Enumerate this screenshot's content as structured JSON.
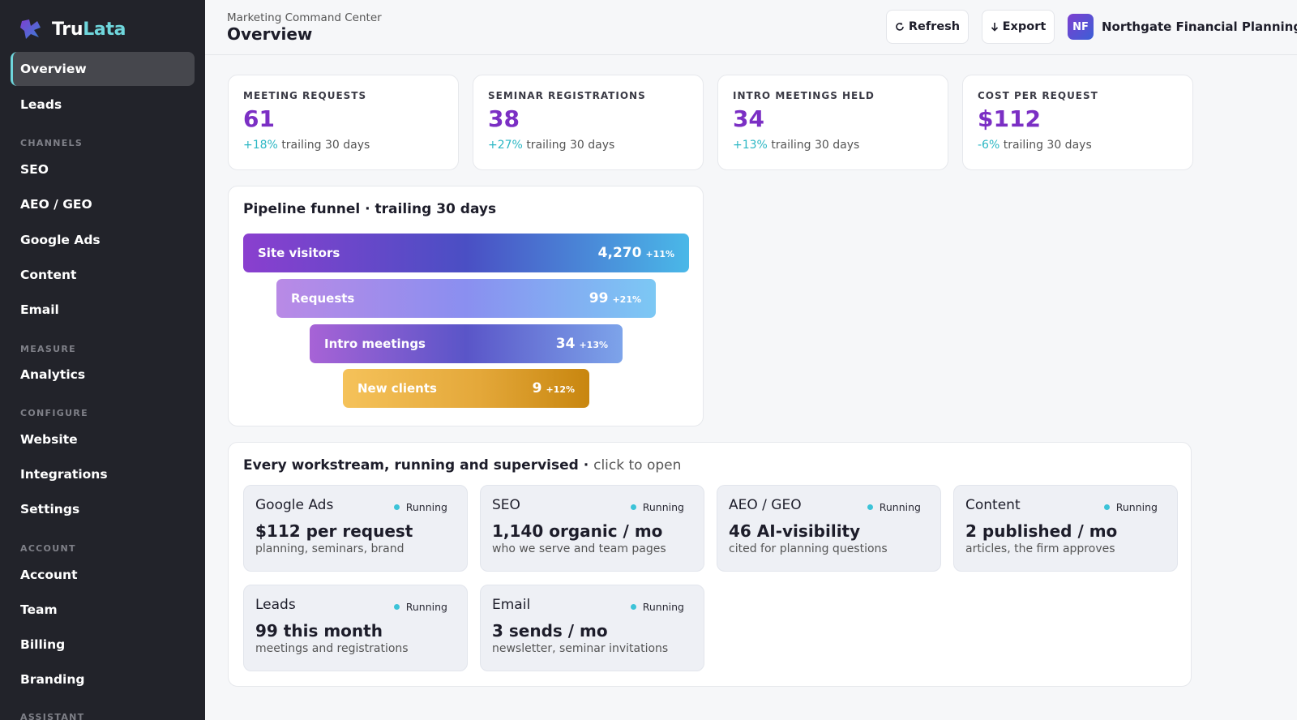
{
  "brand": {
    "name_primary": "Tru",
    "name_accent": "Lata"
  },
  "sidebar": {
    "items": [
      {
        "label": "Overview"
      },
      {
        "label": "Leads"
      },
      {
        "label": "SEO"
      },
      {
        "label": "AEO / GEO"
      },
      {
        "label": "Google Ads"
      },
      {
        "label": "Content"
      },
      {
        "label": "Email"
      },
      {
        "label": "Analytics"
      },
      {
        "label": "Website"
      },
      {
        "label": "Integrations"
      },
      {
        "label": "Settings"
      },
      {
        "label": "Account"
      },
      {
        "label": "Team"
      },
      {
        "label": "Billing"
      },
      {
        "label": "Branding"
      }
    ],
    "sections": {
      "channels": "CHANNELS",
      "measure": "MEASURE",
      "configure": "CONFIGURE",
      "account": "ACCOUNT",
      "assistant": "ASSISTANT"
    }
  },
  "header": {
    "breadcrumb": "Marketing Command Center",
    "title": "Overview",
    "refresh_label": "Refresh",
    "export_label": "Export",
    "org_initials": "NF",
    "org_name": "Northgate Financial Planning"
  },
  "kpis": [
    {
      "label": "MEETING REQUESTS",
      "value": "61",
      "delta": "+18%",
      "period": "trailing 30 days"
    },
    {
      "label": "SEMINAR REGISTRATIONS",
      "value": "38",
      "delta": "+27%",
      "period": "trailing 30 days"
    },
    {
      "label": "INTRO MEETINGS HELD",
      "value": "34",
      "delta": "+13%",
      "period": "trailing 30 days"
    },
    {
      "label": "COST PER REQUEST",
      "value": "$112",
      "delta": "-6%",
      "period": "trailing 30 days"
    }
  ],
  "funnel": {
    "title": "Pipeline funnel · trailing 30 days",
    "stages": [
      {
        "label": "Site visitors",
        "value": "4,270",
        "delta": "+11%"
      },
      {
        "label": "Requests",
        "value": "99",
        "delta": "+21%"
      },
      {
        "label": "Intro meetings",
        "value": "34",
        "delta": "+13%"
      },
      {
        "label": "New clients",
        "value": "9",
        "delta": "+12%"
      }
    ]
  },
  "workstreams": {
    "title": "Every workstream, running and supervised ·",
    "subtitle": "click to open",
    "items": [
      {
        "name": "Google Ads",
        "status": "Running",
        "metric": "$112 per request",
        "desc": "planning, seminars, brand"
      },
      {
        "name": "SEO",
        "status": "Running",
        "metric": "1,140 organic / mo",
        "desc": "who we serve and team pages"
      },
      {
        "name": "AEO / GEO",
        "status": "Running",
        "metric": "46 AI-visibility",
        "desc": "cited for planning questions"
      },
      {
        "name": "Content",
        "status": "Running",
        "metric": "2 published / mo",
        "desc": "articles, the firm approves"
      },
      {
        "name": "Leads",
        "status": "Running",
        "metric": "99 this month",
        "desc": "meetings and registrations"
      },
      {
        "name": "Email",
        "status": "Running",
        "metric": "3 sends / mo",
        "desc": "newsletter, seminar invitations"
      }
    ]
  },
  "colors": {
    "accent": "#7b2fc4",
    "teal": "#6fd6dc",
    "sidebar_bg": "#22232a",
    "status_dot": "#3cc3d8"
  },
  "icons": {
    "logo": "brand-logo-icon",
    "refresh": "refresh-icon",
    "export": "arrow-down-icon",
    "status": "status-dot-icon"
  }
}
